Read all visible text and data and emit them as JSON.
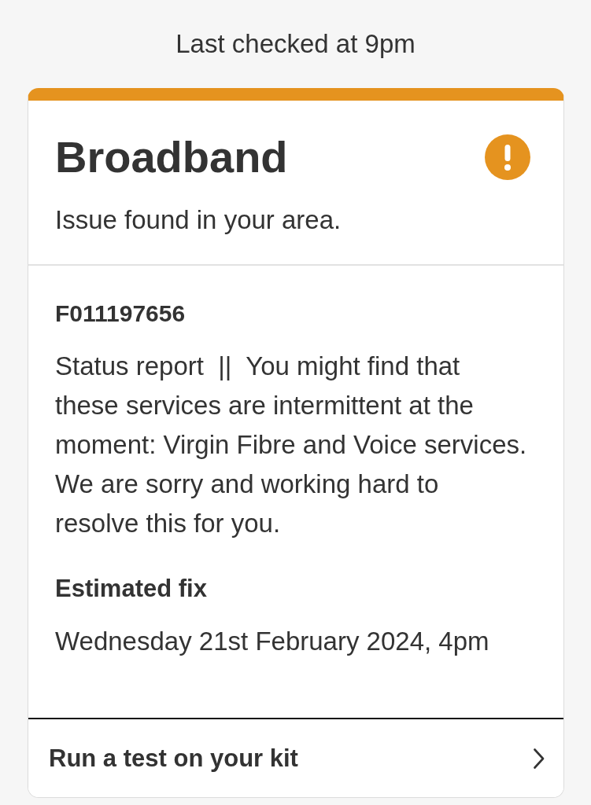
{
  "last_checked": "Last checked at 9pm",
  "service_card": {
    "title": "Broadband",
    "summary": "Issue found in your area.",
    "reference": "F011197656",
    "message": "Status report  ||  You might find that these services are intermittent at the moment: Virgin Fibre and Voice services. We are sorry and working hard to resolve this for you.",
    "fix_heading": "Estimated fix",
    "fix_time": "Wednesday 21st February 2024, 4pm",
    "action": "Run a test on your kit"
  }
}
